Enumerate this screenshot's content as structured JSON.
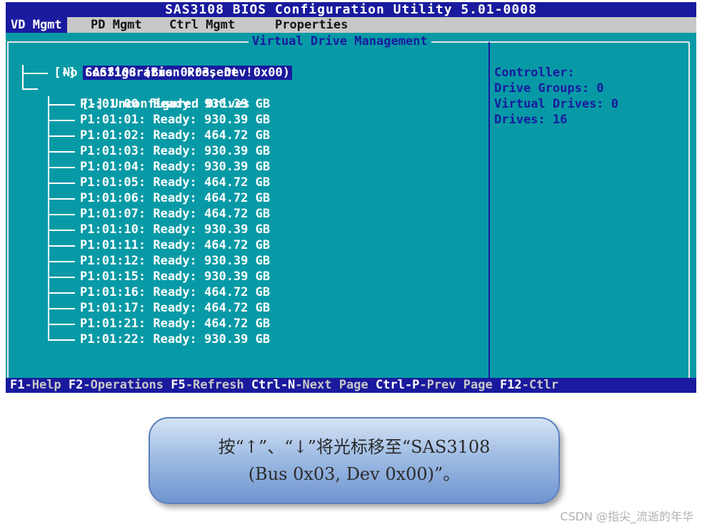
{
  "title": "SAS3108 BIOS Configuration Utility 5.01-0008",
  "menu": [
    "VD Mgmt",
    "PD Mgmt",
    "Ctrl Mgmt",
    "Properties"
  ],
  "panel_title": "Virtual Drive Management",
  "tree": {
    "root_toggle": "[-]",
    "root_label": "SAS3108 (Bus 0x03, Dev 0x00)",
    "no_config": "No Configuration Present !",
    "unconfigured_toggle": "[-]",
    "unconfigured_label": "Unconfigured Drives",
    "drives": [
      "P1:01:00: Ready: 930.39 GB",
      "P1:01:01: Ready: 930.39 GB",
      "P1:01:02: Ready: 464.72 GB",
      "P1:01:03: Ready: 930.39 GB",
      "P1:01:04: Ready: 930.39 GB",
      "P1:01:05: Ready: 464.72 GB",
      "P1:01:06: Ready: 464.72 GB",
      "P1:01:07: Ready: 464.72 GB",
      "P1:01:10: Ready: 930.39 GB",
      "P1:01:11: Ready: 464.72 GB",
      "P1:01:12: Ready: 930.39 GB",
      "P1:01:15: Ready: 930.39 GB",
      "P1:01:16: Ready: 464.72 GB",
      "P1:01:17: Ready: 464.72 GB",
      "P1:01:21: Ready: 464.72 GB",
      "P1:01:22: Ready: 930.39 GB"
    ]
  },
  "info": {
    "controller": "Controller:",
    "drive_groups": "Drive Groups: 0",
    "virtual_drives": "Virtual Drives: 0",
    "drives": "Drives: 16"
  },
  "status": {
    "f1_key": "F1",
    "f1_desc": "-Help",
    "f2_key": "F2",
    "f2_desc": "-Operations",
    "f5_key": "F5",
    "f5_desc": "-Refresh",
    "ctrln_key": "Ctrl-N",
    "ctrln_desc": "-Next Page",
    "ctrlp_key": "Ctrl-P",
    "ctrlp_desc": "-Prev Page",
    "f12_key": "F12",
    "f12_desc": "-Ctlr"
  },
  "callout": {
    "line1": "按“↑”、“↓”将光标移至“SAS3108",
    "line2": "(Bus 0x03, Dev 0x00)”。"
  },
  "watermark": "CSDN @指尖_流逝的年华",
  "colors": {
    "background": "#079aa6",
    "title_bar": "#1a1a9e",
    "menu_bar": "#c8c8c8",
    "text": "#ffffff",
    "info_text": "#1a1a9e"
  }
}
